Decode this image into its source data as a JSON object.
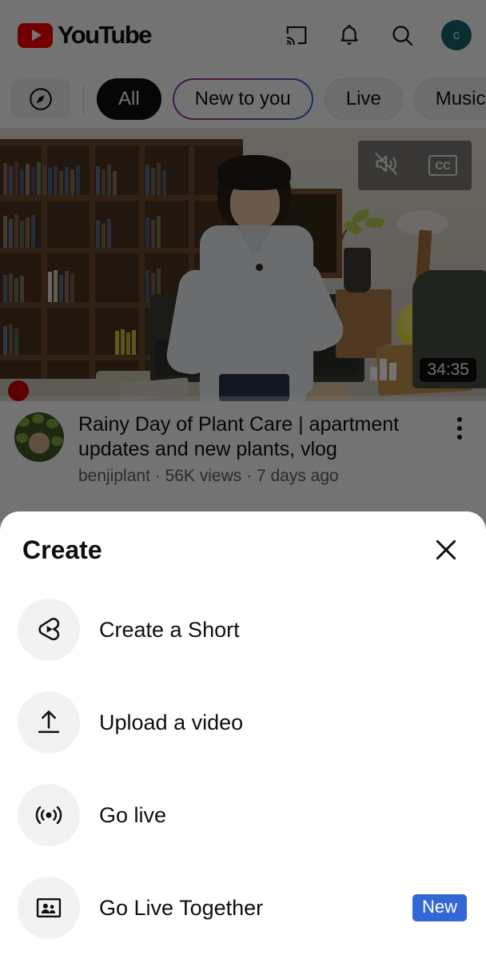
{
  "app": {
    "name": "YouTube",
    "logo_label": "YouTube"
  },
  "header": {
    "brand": "YouTube",
    "icons": [
      {
        "name": "cast-icon",
        "label": "Cast"
      },
      {
        "name": "bell-icon",
        "label": "Notifications"
      },
      {
        "name": "search-icon",
        "label": "Search"
      }
    ],
    "avatar_initial": "c",
    "avatar_color": "#14646e"
  },
  "chips": {
    "explore_icon": "compass-icon",
    "items": [
      {
        "label": "All",
        "state": "selected"
      },
      {
        "label": "New to you",
        "state": "gradient"
      },
      {
        "label": "Live",
        "state": "default"
      },
      {
        "label": "Music",
        "state": "default"
      }
    ]
  },
  "video": {
    "title": "Rainy Day of Plant Care | apartment updates and new plants, vlog",
    "channel": "benjiplant",
    "views": "56K views",
    "published": "7 days ago",
    "meta_line": "benjiplant · 56K views · 7 days ago",
    "duration": "34:35",
    "overlay_icons": [
      {
        "name": "mute-icon",
        "label": "Muted"
      },
      {
        "name": "closed-captions-icon",
        "label": "CC"
      }
    ],
    "cc_label": "CC",
    "progress_percent": 2
  },
  "sheet": {
    "title": "Create",
    "close_label": "Close",
    "items": [
      {
        "icon": "shorts-icon",
        "label": "Create a Short",
        "badge": null
      },
      {
        "icon": "upload-icon",
        "label": "Upload a video",
        "badge": null
      },
      {
        "icon": "broadcast-icon",
        "label": "Go live",
        "badge": null
      },
      {
        "icon": "go-live-together-icon",
        "label": "Go Live Together",
        "badge": "New"
      }
    ],
    "badge_color": "#3367d6"
  },
  "colors": {
    "brand_red": "#ff0000",
    "text_primary": "#0f0f0f",
    "text_secondary": "#606060",
    "surface": "#ffffff",
    "chip_bg": "#f2f2f2",
    "scrim": "rgba(0,0,0,0.55)"
  }
}
